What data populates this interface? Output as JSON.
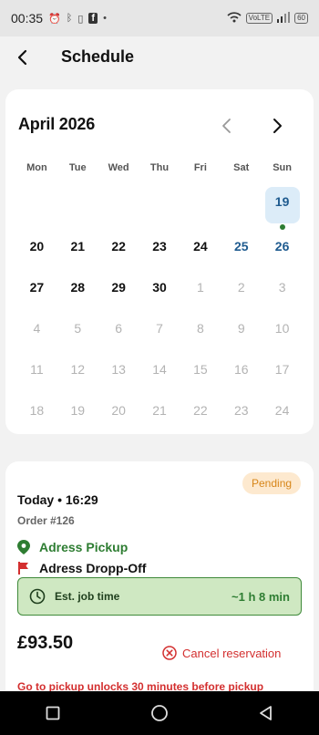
{
  "status_bar": {
    "time": "00:35",
    "icons": [
      "alarm-icon",
      "bluetooth-icon",
      "vibrate-icon",
      "facebook-icon",
      "dot-icon"
    ],
    "right_icons": [
      "wifi-icon",
      "volte-icon",
      "signal-icon",
      "battery-icon"
    ],
    "volte_label": "VoLTE",
    "battery_label": "60"
  },
  "header": {
    "title": "Schedule"
  },
  "calendar": {
    "month_label": "April 2026",
    "weekdays": [
      "Mon",
      "Tue",
      "Wed",
      "Thu",
      "Fri",
      "Sat",
      "Sun"
    ],
    "today": "19",
    "weeks": [
      [
        "",
        "",
        "",
        "",
        "",
        "",
        "19"
      ],
      [
        "20",
        "21",
        "22",
        "23",
        "24",
        "25",
        "26"
      ],
      [
        "27",
        "28",
        "29",
        "30",
        "1",
        "2",
        "3"
      ],
      [
        "4",
        "5",
        "6",
        "7",
        "8",
        "9",
        "10"
      ],
      [
        "11",
        "12",
        "13",
        "14",
        "15",
        "16",
        "17"
      ],
      [
        "18",
        "19",
        "20",
        "21",
        "22",
        "23",
        "24"
      ]
    ]
  },
  "order": {
    "status": "Pending",
    "time": "Today • 16:29",
    "order_no": "Order #126",
    "pickup": "Adress Pickup",
    "dropoff": "Adress Dropp-Off",
    "est_label": "Est. job time",
    "est_value": "~1 h 8 min",
    "price": "£93.50",
    "cancel_label": "Cancel reservation",
    "warning": "Go to pickup unlocks 30 minutes before pickup"
  },
  "colors": {
    "accent_green": "#2e7d32",
    "accent_blue": "#1f5b8f",
    "pending": "#d7861a",
    "danger": "#d32f2f"
  }
}
